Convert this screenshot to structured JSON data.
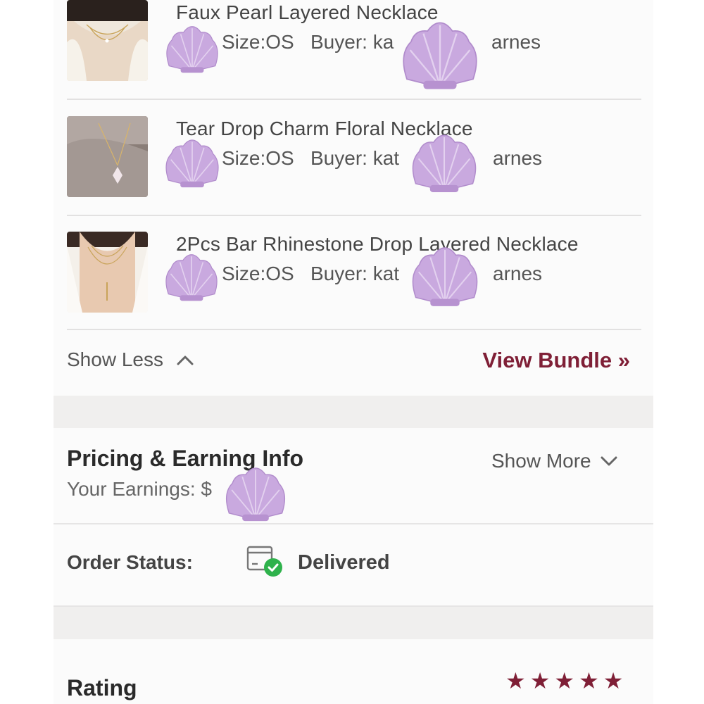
{
  "items": [
    {
      "title": "Faux Pearl Layered Necklace",
      "size": "Size:OS",
      "buyer": "Buyer: ka",
      "buyer_tail": "arnes",
      "thumb_icon": "necklace-photo"
    },
    {
      "title": "Tear Drop Charm Floral Necklace",
      "size": "Size:OS",
      "buyer": "Buyer: kat",
      "buyer_tail": "arnes",
      "thumb_icon": "necklace-photo"
    },
    {
      "title": "2Pcs Bar Rhinestone Drop Layered Necklace",
      "size": "Size:OS",
      "buyer": "Buyer: kat",
      "buyer_tail": "arnes",
      "thumb_icon": "necklace-photo"
    }
  ],
  "bundle": {
    "show_less": "Show Less",
    "view_bundle": "View Bundle »"
  },
  "pricing": {
    "title": "Pricing & Earning Info",
    "earnings_label": "Your Earnings: $",
    "show_more": "Show More"
  },
  "order": {
    "status_label": "Order Status:",
    "status_value": "Delivered"
  },
  "rating": {
    "label": "Rating",
    "stars": 5
  },
  "colors": {
    "accent": "#7f1f36",
    "shell": "#c9a9df",
    "delivered_check": "#2fb24c"
  }
}
